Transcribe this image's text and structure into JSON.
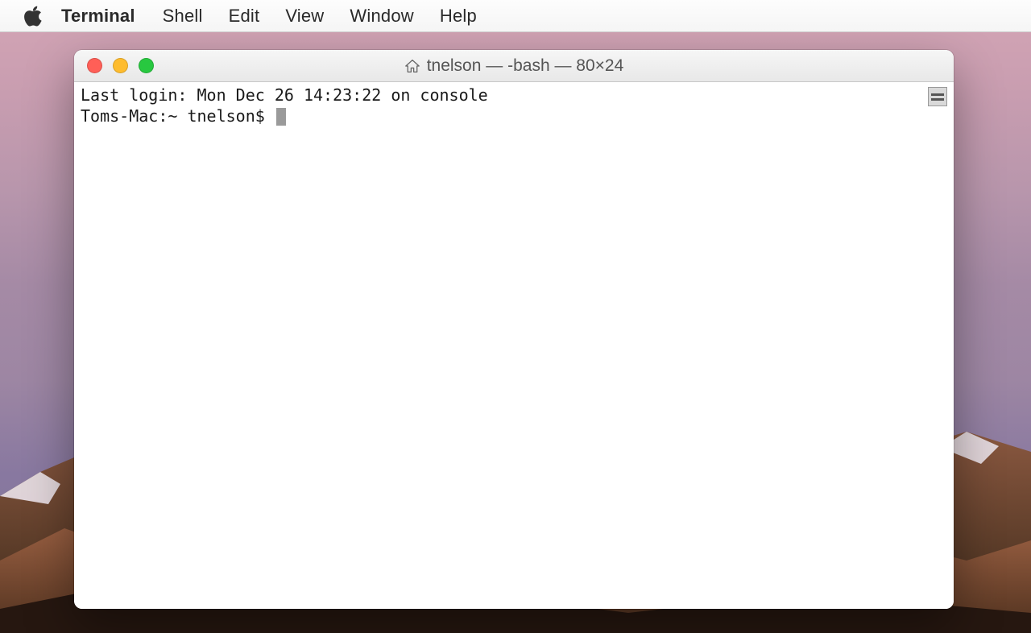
{
  "menubar": {
    "app_name": "Terminal",
    "items": [
      "Shell",
      "Edit",
      "View",
      "Window",
      "Help"
    ]
  },
  "window": {
    "title": "tnelson — -bash — 80×24"
  },
  "terminal": {
    "last_login": "Last login: Mon Dec 26 14:23:22 on console",
    "prompt": "Toms-Mac:~ tnelson$ "
  }
}
